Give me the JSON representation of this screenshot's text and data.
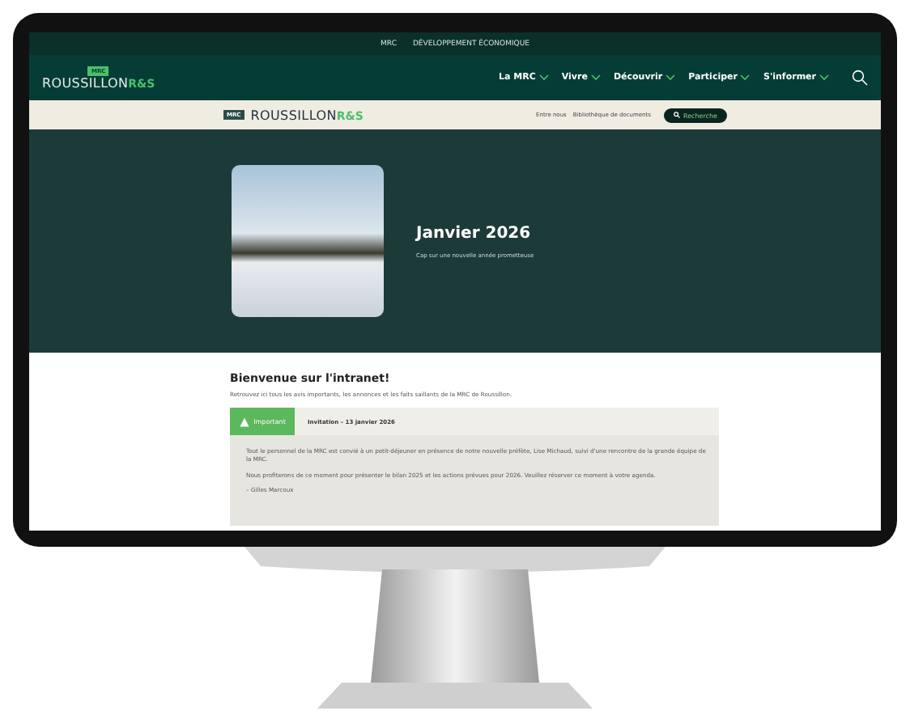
{
  "top_bar": {
    "links": [
      "MRC",
      "DÉVELOPPEMENT ÉCONOMIQUE"
    ]
  },
  "header": {
    "logo": {
      "badge": "MRC",
      "name": "ROUSSILLON",
      "suffix": "R&S"
    },
    "nav": [
      {
        "label": "La MRC"
      },
      {
        "label": "Vivre"
      },
      {
        "label": "Découvrir"
      },
      {
        "label": "Participer"
      },
      {
        "label": "S'informer"
      }
    ]
  },
  "secondary_bar": {
    "logo": {
      "badge": "MRC",
      "name": "ROUSSILLON",
      "suffix": "R&S"
    },
    "links": [
      "Entre nous",
      "Bibliothèque de documents"
    ],
    "search_button": "Recherche"
  },
  "hero": {
    "title": "Janvier 2026",
    "subtitle": "Cap sur une nouvelle année prometteuse"
  },
  "intro": {
    "title": "Bienvenue sur l'intranet!",
    "text": "Retrouvez ici tous les avis importants, les annonces et les faits saillants de la MRC de Roussillon."
  },
  "notice": {
    "tag": "Important",
    "title": "Invitation – 13 janvier 2026",
    "paragraphs": [
      "Tout le personnel de la MRC est convié à un petit-déjeuner en présence de notre nouvelle préfète, Lise Michaud, suivi d'une rencontre de la grande équipe de la MRC.",
      "Nous profiterons de ce moment pour présenter le bilan 2025 et les actions prévues pour 2026. Veuillez réserver ce moment à votre agenda."
    ],
    "signature": "– Gilles Marcoux"
  }
}
